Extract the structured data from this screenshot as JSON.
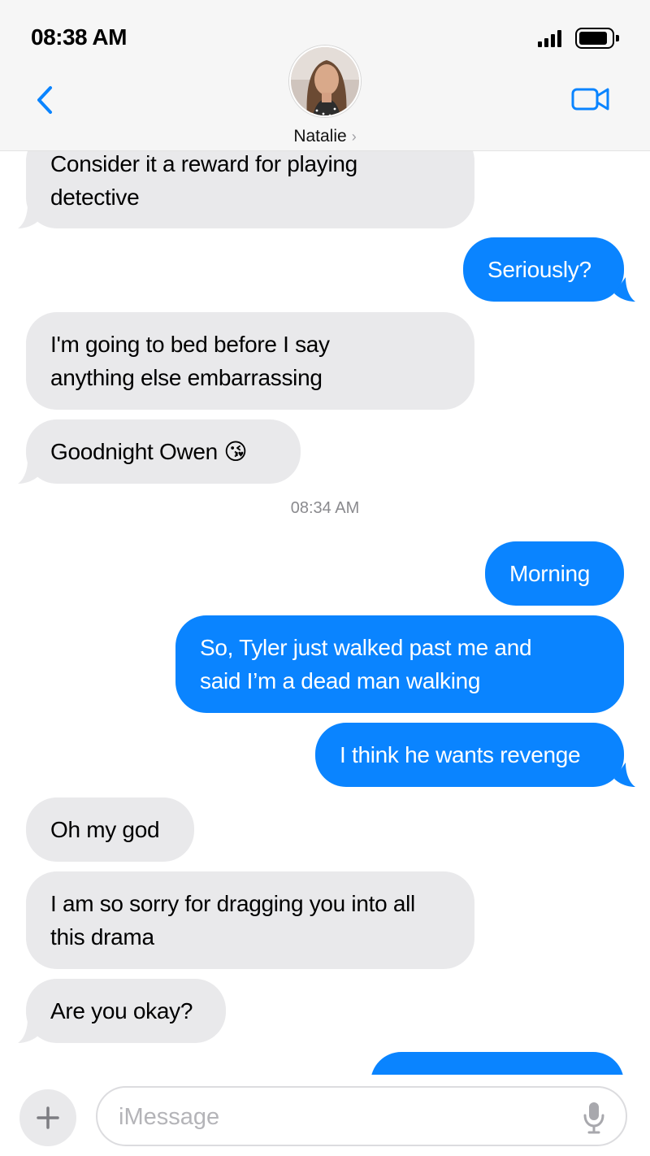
{
  "status_bar": {
    "time": "08:38 AM"
  },
  "header": {
    "contact_name": "Natalie",
    "chevron": "›",
    "back_icon": "chevron-left-icon",
    "video_icon": "video-camera-icon"
  },
  "colors": {
    "outgoing": "#0a84ff",
    "incoming": "#e9e9eb",
    "accent": "#0a84ff"
  },
  "messages": [
    {
      "direction": "in",
      "lines": [
        "Consider it a reward for playing",
        "detective"
      ]
    },
    {
      "direction": "out",
      "lines": [
        "Seriously?"
      ]
    },
    {
      "direction": "in",
      "lines": [
        "I'm going to bed before I say",
        "anything else embarrassing"
      ]
    },
    {
      "direction": "in",
      "lines": [
        "Goodnight Owen"
      ],
      "emoji": "😘"
    },
    {
      "direction": "out",
      "lines": [
        "Morning"
      ]
    },
    {
      "direction": "out",
      "lines": [
        "So, Tyler just walked past me and",
        "said I’m a dead man walking"
      ]
    },
    {
      "direction": "out",
      "lines": [
        "I think he wants revenge"
      ]
    },
    {
      "direction": "in",
      "lines": [
        "Oh my god"
      ]
    },
    {
      "direction": "in",
      "lines": [
        "I am so sorry for dragging you into all",
        "this drama"
      ]
    },
    {
      "direction": "in",
      "lines": [
        "Are you okay?"
      ]
    }
  ],
  "timestamp": "08:34 AM",
  "composer": {
    "placeholder": "iMessage",
    "value": "",
    "plus_icon": "plus-icon",
    "mic_icon": "microphone-icon"
  }
}
